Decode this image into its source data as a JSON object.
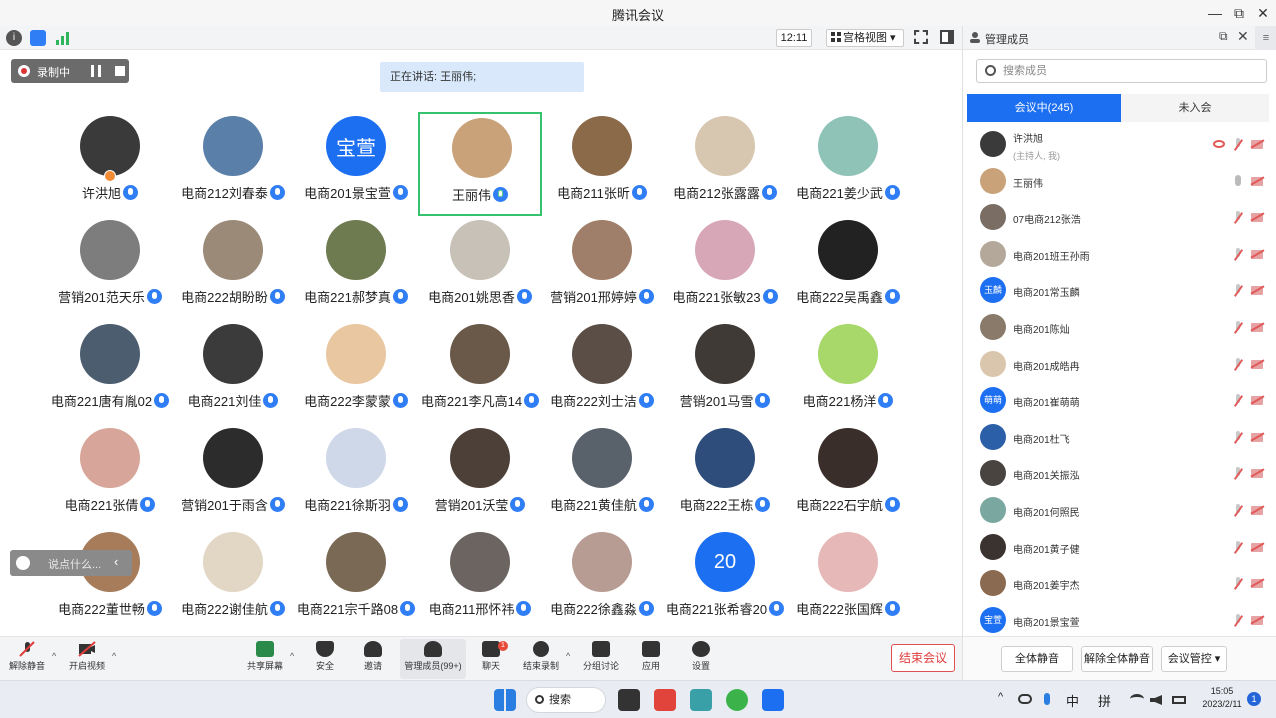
{
  "window": {
    "title": "腾讯会议",
    "minimize": "—",
    "restore": "⧉",
    "close": "✕"
  },
  "toolbar": {
    "info_icon": "info-icon",
    "shield_icon": "shield-icon",
    "signal_icon": "signal-icon",
    "clock": "12:11",
    "view_mode": "宫格视图 ▾",
    "fullscreen_icon": "fullscreen-icon",
    "sidebar_toggle_icon": "sidebar-toggle-icon"
  },
  "recording": {
    "label": "录制中"
  },
  "speaking": {
    "text": "正在讲话: 王丽伟;"
  },
  "chat": {
    "placeholder": "说点什么...",
    "arrow": "‹"
  },
  "participants": [
    {
      "name": "许洪旭",
      "color": "#3a3a3a",
      "initial": "",
      "host": true
    },
    {
      "name": "电商212刘春泰",
      "color": "#5a7fa8",
      "initial": ""
    },
    {
      "name": "电商201景宝萱",
      "color": "#1d6ff2",
      "initial": "宝萱"
    },
    {
      "name": "王丽伟",
      "color": "#c9a27a",
      "initial": "",
      "active": true
    },
    {
      "name": "电商211张昕",
      "color": "#8b6a4a",
      "initial": ""
    },
    {
      "name": "电商212张露露",
      "color": "#d8c7b0",
      "initial": ""
    },
    {
      "name": "电商221姜少武",
      "color": "#8fc3b8",
      "initial": ""
    },
    {
      "name": "营销201范天乐",
      "color": "#7d7d7d",
      "initial": ""
    },
    {
      "name": "电商222胡盼盼",
      "color": "#9b8a78",
      "initial": ""
    },
    {
      "name": "电商221郝梦真",
      "color": "#6e7a50",
      "initial": ""
    },
    {
      "name": "电商201姚思香",
      "color": "#c7c1b8",
      "initial": ""
    },
    {
      "name": "营销201邢婷婷",
      "color": "#a07f6a",
      "initial": ""
    },
    {
      "name": "电商221张敏23",
      "color": "#d7a7b8",
      "initial": ""
    },
    {
      "name": "电商222吴禹鑫",
      "color": "#222222",
      "initial": ""
    },
    {
      "name": "电商221唐有胤02",
      "color": "#4b5d6e",
      "initial": ""
    },
    {
      "name": "电商221刘佳",
      "color": "#3b3b3b",
      "initial": ""
    },
    {
      "name": "电商222李蒙蒙",
      "color": "#e9c7a0",
      "initial": ""
    },
    {
      "name": "电商221李凡高14",
      "color": "#6a5848",
      "initial": ""
    },
    {
      "name": "电商222刘士洁",
      "color": "#5a4e46",
      "initial": ""
    },
    {
      "name": "营销201马雪",
      "color": "#3f3a35",
      "initial": ""
    },
    {
      "name": "电商221杨洋",
      "color": "#a8d86a",
      "initial": ""
    },
    {
      "name": "电商221张倩",
      "color": "#d7a59a",
      "initial": ""
    },
    {
      "name": "营销201于雨含",
      "color": "#2c2c2c",
      "initial": ""
    },
    {
      "name": "电商221徐斯羽",
      "color": "#cfd8e8",
      "initial": ""
    },
    {
      "name": "营销201沃莹",
      "color": "#4d4038",
      "initial": ""
    },
    {
      "name": "电商221黄佳航",
      "color": "#59626b",
      "initial": ""
    },
    {
      "name": "电商222王栋",
      "color": "#2e4d7a",
      "initial": ""
    },
    {
      "name": "电商222石宇航",
      "color": "#3a2e2a",
      "initial": ""
    },
    {
      "name": "电商222董世畅",
      "color": "#a67c5a",
      "initial": ""
    },
    {
      "name": "电商222谢佳航",
      "color": "#e2d6c4",
      "initial": ""
    },
    {
      "name": "电商221宗千路08",
      "color": "#7a6a55",
      "initial": ""
    },
    {
      "name": "电商211邢怀祎",
      "color": "#6b6460",
      "initial": ""
    },
    {
      "name": "电商222徐鑫淼",
      "color": "#b79c93",
      "initial": ""
    },
    {
      "name": "电商221张希睿20",
      "color": "#1d6ff2",
      "initial": "20"
    },
    {
      "name": "电商222张国辉",
      "color": "#e7b8b8",
      "initial": ""
    }
  ],
  "controls": {
    "unmute": "解除静音",
    "start_video": "开启视频",
    "share_screen": "共享屏幕",
    "security": "安全",
    "invite": "邀请",
    "manage_members": "管理成员(99+)",
    "chat": "聊天",
    "chat_badge": "1",
    "end_recording": "结束录制",
    "breakout": "分组讨论",
    "apps": "应用",
    "settings": "设置",
    "end_meeting": "结束会议",
    "caret": "^"
  },
  "panel": {
    "title": "管理成员",
    "pop_out": "⧉",
    "close": "✕",
    "menu": "≡",
    "search_placeholder": "搜索成员",
    "tab_in_meeting": "会议中(245)",
    "tab_not_joined": "未入会",
    "members": [
      {
        "name": "许洪旭",
        "sub": "(主持人, 我)",
        "color": "#3a3a3a",
        "initial": "",
        "mic": "off",
        "eye": true
      },
      {
        "name": "王丽伟",
        "sub": "",
        "color": "#c9a27a",
        "initial": "",
        "mic": "on"
      },
      {
        "name": "07电商212张浩",
        "sub": "",
        "color": "#7a6e64",
        "initial": "",
        "mic": "off"
      },
      {
        "name": "电商201班王孙雨",
        "sub": "",
        "color": "#b4a89a",
        "initial": "",
        "mic": "off"
      },
      {
        "name": "电商201常玉麟",
        "sub": "",
        "color": "#1d6ff2",
        "initial": "玉麟",
        "mic": "off"
      },
      {
        "name": "电商201陈灿",
        "sub": "",
        "color": "#8a7a6a",
        "initial": "",
        "mic": "off"
      },
      {
        "name": "电商201成皓冉",
        "sub": "",
        "color": "#d9c6ac",
        "initial": "",
        "mic": "off"
      },
      {
        "name": "电商201崔萌萌",
        "sub": "",
        "color": "#1d6ff2",
        "initial": "萌萌",
        "mic": "off"
      },
      {
        "name": "电商201杜飞",
        "sub": "",
        "color": "#2b5fa8",
        "initial": "",
        "mic": "off"
      },
      {
        "name": "电商201关振泓",
        "sub": "",
        "color": "#4a4440",
        "initial": "",
        "mic": "off"
      },
      {
        "name": "电商201何照民",
        "sub": "",
        "color": "#7aa8a0",
        "initial": "",
        "mic": "off"
      },
      {
        "name": "电商201黄子健",
        "sub": "",
        "color": "#3a3330",
        "initial": "",
        "mic": "off"
      },
      {
        "name": "电商201姜宇杰",
        "sub": "",
        "color": "#8a6a50",
        "initial": "",
        "mic": "off"
      },
      {
        "name": "电商201景宝萱",
        "sub": "",
        "color": "#1d6ff2",
        "initial": "宝萱",
        "mic": "off"
      }
    ],
    "mute_all": "全体静音",
    "unmute_all": "解除全体静音",
    "meeting_control": "会议管控 ▾"
  },
  "taskbar": {
    "search": "搜索",
    "tray_chevron": "^",
    "ime_mode": "中",
    "ime_layout": "拼",
    "time": "15:05",
    "date": "2023/2/11",
    "notifications": "1"
  }
}
